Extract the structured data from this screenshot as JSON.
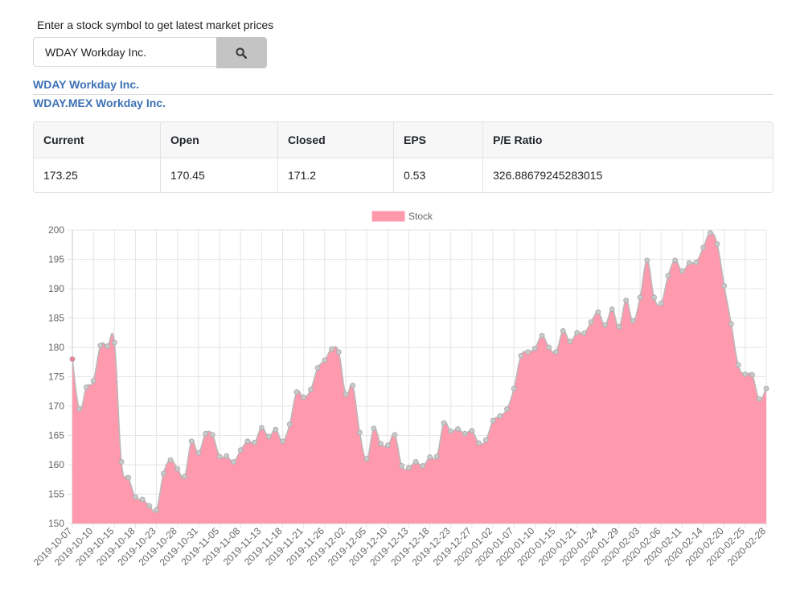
{
  "search": {
    "prompt": "Enter a stock symbol to get latest market prices",
    "value": "WDAY Workday Inc.",
    "button_icon": "search-icon"
  },
  "results": [
    {
      "label": "WDAY Workday Inc."
    },
    {
      "label": "WDAY.MEX Workday Inc."
    }
  ],
  "quote": {
    "headers": [
      "Current",
      "Open",
      "Closed",
      "EPS",
      "P/E Ratio"
    ],
    "values": [
      "173.25",
      "170.45",
      "171.2",
      "0.53",
      "326.88679245283015"
    ]
  },
  "colors": {
    "link": "#3d72b5",
    "area_fill": "#ff9aae",
    "line": "#b8b8b8"
  },
  "chart_data": {
    "type": "area",
    "ylim": [
      150,
      200
    ],
    "yticks": [
      150,
      155,
      160,
      165,
      170,
      175,
      180,
      185,
      190,
      195,
      200
    ],
    "grid": true,
    "legend": "top-center",
    "series": [
      {
        "name": "Stock",
        "values": [
          178,
          169.5,
          173.2,
          174.3,
          180.3,
          180.2,
          180.8,
          160.5,
          157.8,
          154.5,
          154.1,
          153.0,
          152.3,
          158.5,
          160.8,
          159.3,
          158.0,
          164.0,
          162.0,
          165.3,
          165.1,
          161.4,
          161.5,
          160.5,
          162.5,
          164.0,
          163.8,
          166.3,
          164.8,
          166.0,
          164.0,
          166.9,
          172.4,
          171.5,
          172.8,
          176.5,
          177.8,
          179.7,
          179.2,
          172.0,
          173.5,
          165.5,
          161.0,
          166.2,
          163.6,
          163.3,
          165.1,
          159.8,
          159.5,
          160.5,
          159.8,
          161.3,
          161.4,
          167.1,
          165.7,
          166.1,
          165.3,
          165.8,
          163.7,
          164.2,
          167.5,
          168.3,
          169.5,
          173.0,
          178.6,
          179.2,
          179.8,
          182.0,
          180.0,
          179.2,
          182.8,
          181.0,
          182.5,
          182.4,
          184.3,
          186.0,
          183.8,
          186.5,
          183.5,
          188.0,
          184.5,
          188.5,
          194.8,
          188.5,
          187.5,
          192.2,
          194.8,
          193.0,
          194.4,
          194.5,
          197.0,
          199.5,
          197.6,
          190.5,
          184.0,
          177.0,
          175.4,
          175.3,
          171.2,
          173.0
        ]
      }
    ],
    "x_labels": [
      "2019-10-07",
      "2019-10-10",
      "2019-10-15",
      "2019-10-18",
      "2019-10-23",
      "2019-10-28",
      "2019-10-31",
      "2019-11-05",
      "2019-11-08",
      "2019-11-13",
      "2019-11-18",
      "2019-11-21",
      "2019-11-26",
      "2019-12-02",
      "2019-12-05",
      "2019-12-10",
      "2019-12-13",
      "2019-12-18",
      "2019-12-23",
      "2019-12-27",
      "2020-01-02",
      "2020-01-07",
      "2020-01-10",
      "2020-01-15",
      "2020-01-21",
      "2020-01-24",
      "2020-01-29",
      "2020-02-03",
      "2020-02-06",
      "2020-02-11",
      "2020-02-14",
      "2020-02-20",
      "2020-02-25",
      "2020-02-28"
    ]
  }
}
